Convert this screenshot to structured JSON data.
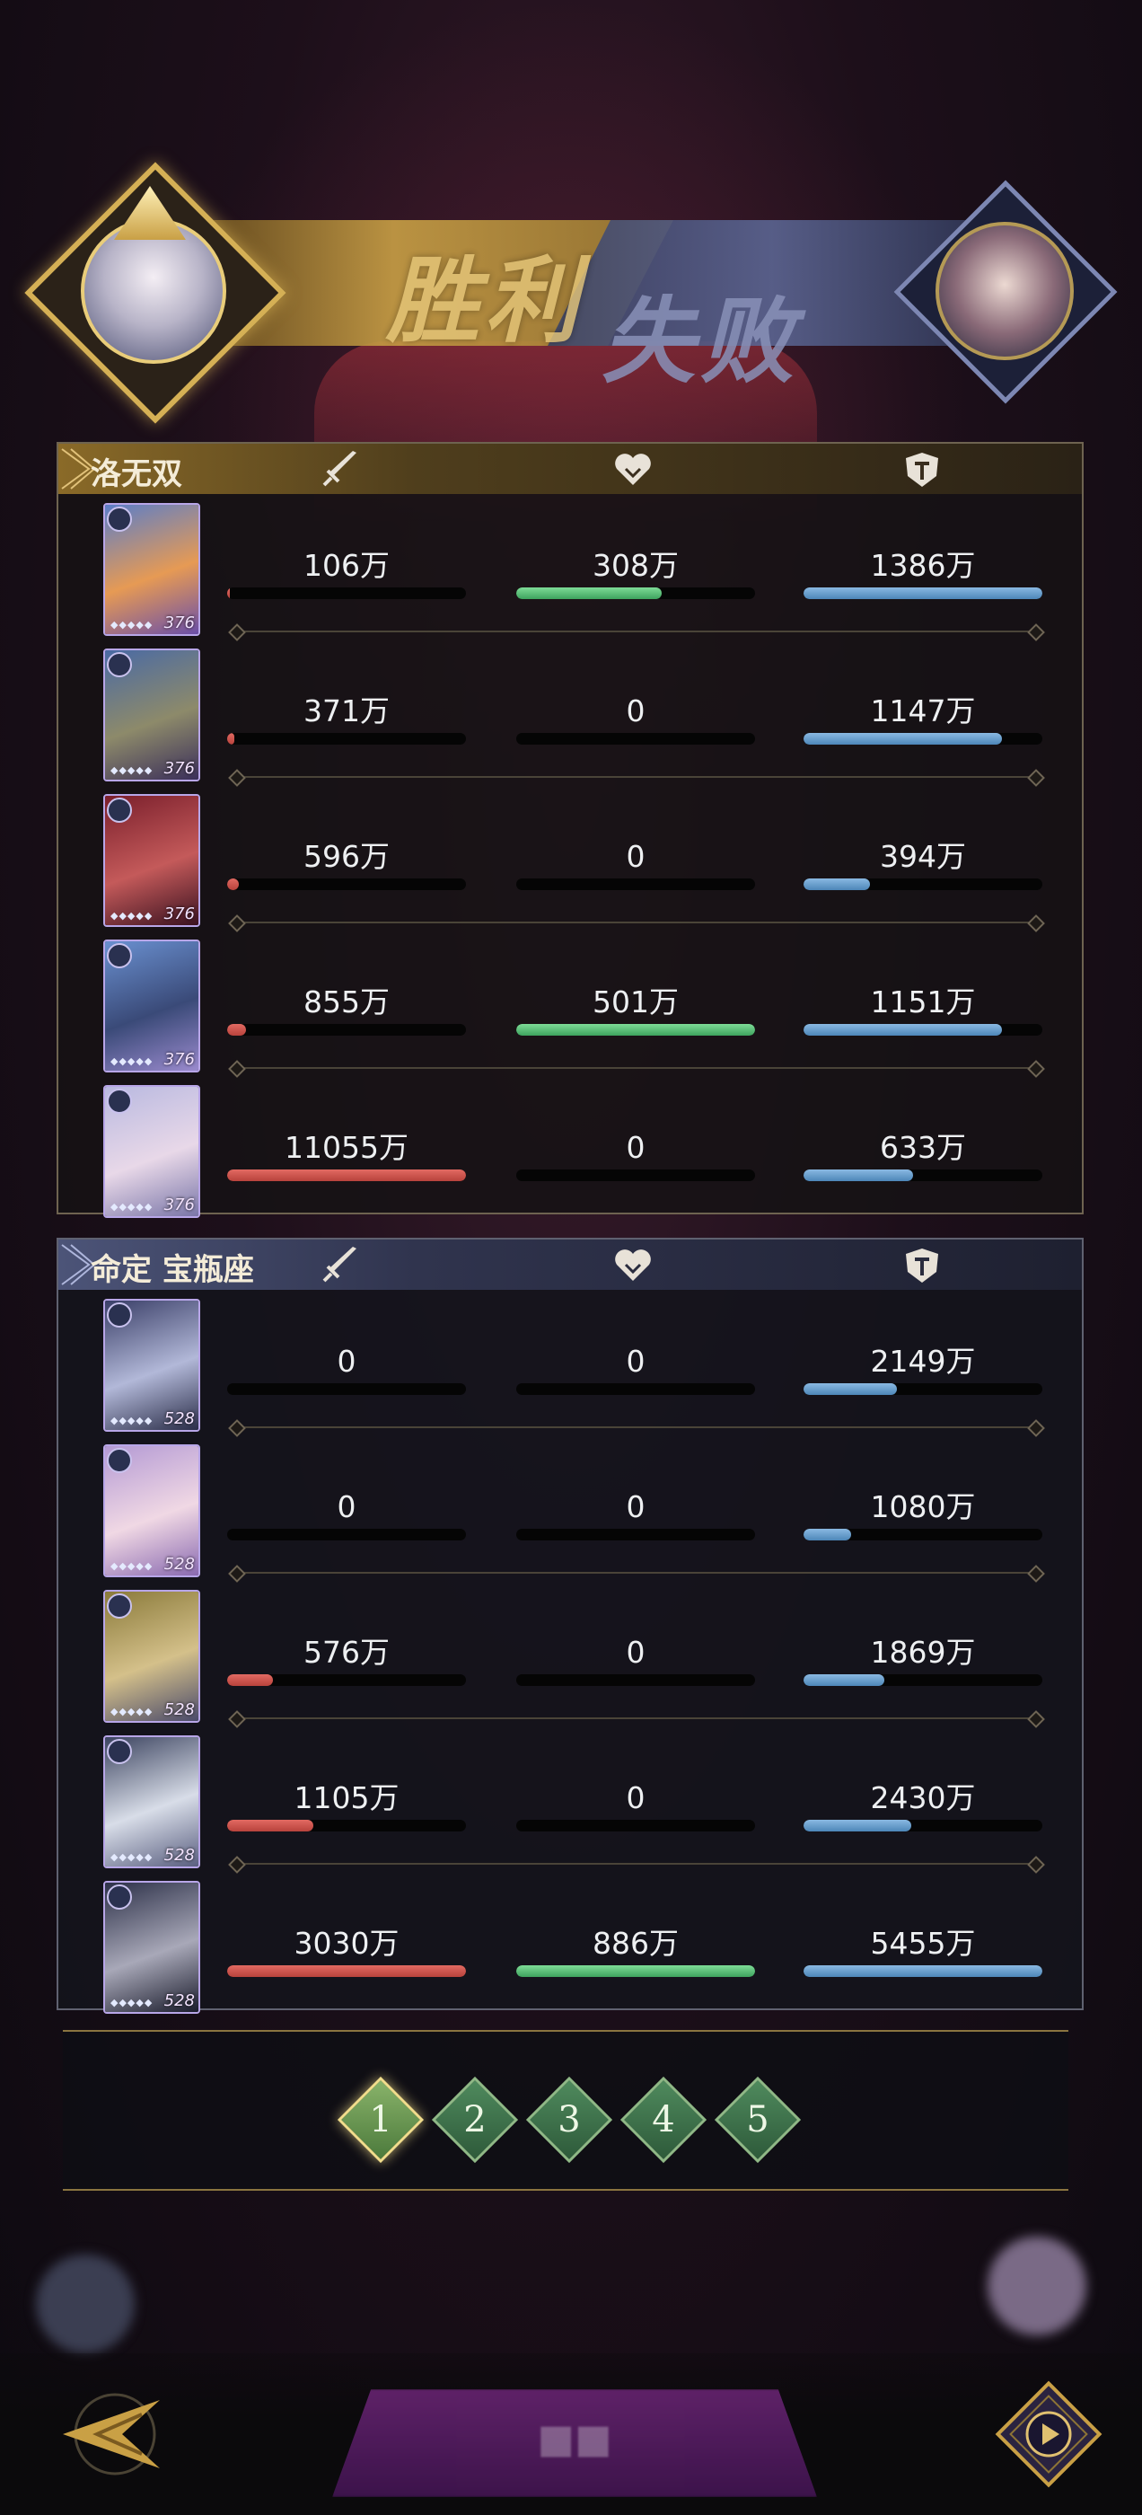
{
  "banner": {
    "left_result": "胜利",
    "right_result": "失败"
  },
  "icons": {
    "attack": "sword-icon",
    "heal": "heart-icon",
    "defense": "shield-icon"
  },
  "colors": {
    "attack": "#d4544d",
    "heal": "#5cc47a",
    "defense": "#6da3d4",
    "victory_gold": "#c9a045",
    "defeat_blue": "#5b6592"
  },
  "team1": {
    "name": "洛无双",
    "rows": [
      {
        "level": "376",
        "atk": "106万",
        "heal": "308万",
        "def": "1386万",
        "atk_pct": 1,
        "heal_pct": 61,
        "def_pct": 100
      },
      {
        "level": "376",
        "atk": "371万",
        "heal": "0",
        "def": "1147万",
        "atk_pct": 3,
        "heal_pct": 0,
        "def_pct": 83
      },
      {
        "level": "376",
        "atk": "596万",
        "heal": "0",
        "def": "394万",
        "atk_pct": 5,
        "heal_pct": 0,
        "def_pct": 28
      },
      {
        "level": "376",
        "atk": "855万",
        "heal": "501万",
        "def": "1151万",
        "atk_pct": 8,
        "heal_pct": 100,
        "def_pct": 83
      },
      {
        "level": "376",
        "atk": "11055万",
        "heal": "0",
        "def": "633万",
        "atk_pct": 100,
        "heal_pct": 0,
        "def_pct": 46
      }
    ]
  },
  "team2": {
    "name": "命定 宝瓶座",
    "rows": [
      {
        "level": "528",
        "atk": "0",
        "heal": "0",
        "def": "2149万",
        "atk_pct": 0,
        "heal_pct": 0,
        "def_pct": 39
      },
      {
        "level": "528",
        "atk": "0",
        "heal": "0",
        "def": "1080万",
        "atk_pct": 0,
        "heal_pct": 0,
        "def_pct": 20
      },
      {
        "level": "528",
        "atk": "576万",
        "heal": "0",
        "def": "1869万",
        "atk_pct": 19,
        "heal_pct": 0,
        "def_pct": 34
      },
      {
        "level": "528",
        "atk": "1105万",
        "heal": "0",
        "def": "2430万",
        "atk_pct": 36,
        "heal_pct": 0,
        "def_pct": 45
      },
      {
        "level": "528",
        "atk": "3030万",
        "heal": "886万",
        "def": "5455万",
        "atk_pct": 100,
        "heal_pct": 100,
        "def_pct": 100
      }
    ]
  },
  "rounds": {
    "labels": [
      "1",
      "2",
      "3",
      "4",
      "5"
    ],
    "active": 0
  }
}
